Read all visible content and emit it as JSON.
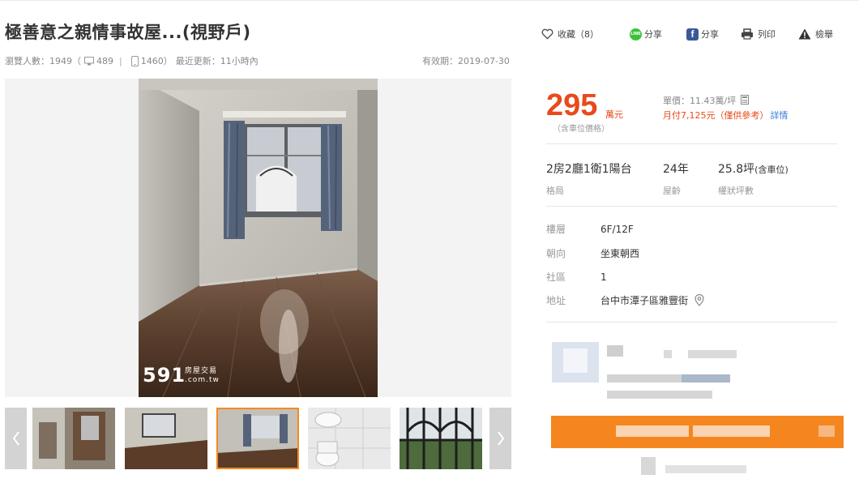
{
  "listing": {
    "title": "極善意之親情事故屋...(視野戶)",
    "views_label": "瀏覽人數：1949（",
    "pc_views": "489",
    "mobile_views": "1460）",
    "updated": "最近更新：11小時內",
    "valid_until": "有效期：2019-07-30"
  },
  "actions": {
    "favorite": "收藏（8）",
    "line_share": "分享",
    "fb_share": "分享",
    "print": "列印",
    "report": "檢舉"
  },
  "price": {
    "amount": "295",
    "unit": "萬元",
    "note": "（含車位價格）",
    "unit_price": "單價：11.43萬/坪",
    "monthly": "月付7,125元（僅供參考）",
    "detail_link": "詳情",
    "color": "#e94a1c"
  },
  "specs": [
    {
      "value": "2房2廳1衛1陽台",
      "label": "格局"
    },
    {
      "value": "24年",
      "label": "屋齡"
    },
    {
      "value": "25.8坪",
      "suffix": "(含車位)",
      "label": "權狀坪數"
    }
  ],
  "details": [
    {
      "key": "樓層",
      "value": "6F/12F"
    },
    {
      "key": "朝向",
      "value": "坐東朝西"
    },
    {
      "key": "社區",
      "value": "1"
    },
    {
      "key": "地址",
      "value": "台中市潭子區雅豐街"
    }
  ],
  "watermark": {
    "logo": "591",
    "sub1": "房屋交易",
    "sub2": ".com.tw"
  },
  "thumbnails": {
    "count": 5,
    "active_index": 2
  },
  "icons": {
    "heart": "heart-icon",
    "line": "line-icon",
    "facebook": "facebook-icon",
    "printer": "printer-icon",
    "warning": "warning-icon",
    "monitor": "monitor-icon",
    "phone": "phone-icon",
    "calculator": "calculator-icon",
    "map_pin": "map-pin-icon",
    "arrow_left": "chevron-left-icon",
    "arrow_right": "chevron-right-icon"
  },
  "colors": {
    "accent": "#f5861f",
    "price": "#e94a1c",
    "link": "#3d7ad6",
    "line_green": "#3ac33a",
    "facebook_blue": "#3b5998"
  }
}
